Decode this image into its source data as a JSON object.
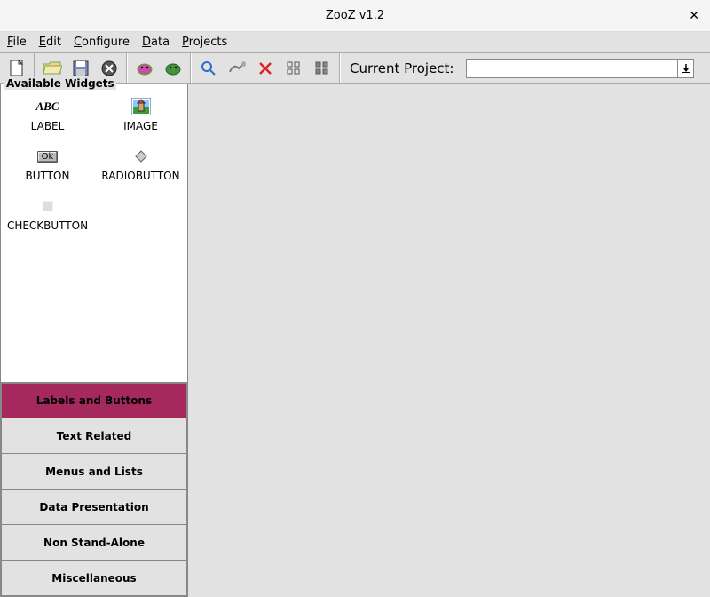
{
  "window": {
    "title": "ZooZ v1.2"
  },
  "menu": {
    "file": "File",
    "edit": "Edit",
    "configure": "Configure",
    "data": "Data",
    "projects": "Projects"
  },
  "toolbar": {
    "current_project_label": "Current Project:",
    "current_project_value": ""
  },
  "sidebar": {
    "group_label": "Available Widgets",
    "widgets": {
      "label": "LABEL",
      "image": "IMAGE",
      "button": "BUTTON",
      "radiobutton": "RADIOBUTTON",
      "checkbutton": "CHECKBUTTON"
    },
    "categories": {
      "labels_buttons": "Labels and Buttons",
      "text_related": "Text Related",
      "menus_lists": "Menus and Lists",
      "data_presentation": "Data Presentation",
      "non_standalone": "Non Stand-Alone",
      "miscellaneous": "Miscellaneous"
    },
    "active_category": "labels_buttons"
  }
}
